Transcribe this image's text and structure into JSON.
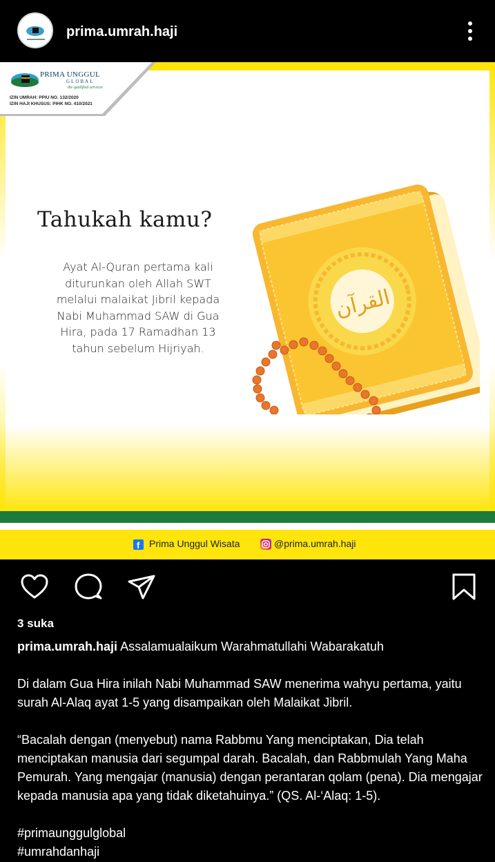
{
  "header": {
    "username": "prima.umrah.haji",
    "avatar_icon": "prima-unggul-logo-avatar",
    "more_icon": "more-vertical-icon"
  },
  "post_image": {
    "logo": {
      "brand_name": "PRIMA UNGGUL",
      "brand_sub": "GLOBAL",
      "tagline": "the qualified services",
      "izin_umrah": "IZIN UMRAH: PPIU NO. 132/2020",
      "izin_haji": "IZIN HAJI KHUSUS: PIHK NO. 410/2021"
    },
    "title": "Tahukah kamu?",
    "body_lines": [
      "Ayat Al-Quran pertama kali",
      "diturunkan oleh Allah SWT",
      "melalui malaikat Jibril kepada",
      "Nabi Muhammad SAW  di Gua",
      "Hira, pada 17 Ramadhan 13",
      "tahun sebelum Hijriyah."
    ],
    "quran_label": "القرآن",
    "footer": {
      "facebook_label": "Prima Unggul Wisata",
      "instagram_label": "@prima.umrah.haji"
    },
    "colors": {
      "yellow": "#ffe50c",
      "green": "#1f7a3e",
      "book": "#f7b731",
      "beads": "#e8762b"
    }
  },
  "actions": {
    "like_icon": "heart-icon",
    "comment_icon": "comment-icon",
    "share_icon": "send-icon",
    "save_icon": "bookmark-icon"
  },
  "likes": "3 suka",
  "caption": {
    "username": "prima.umrah.haji",
    "first_line": "Assalamualaikum Warahmatullahi Wabarakatuh",
    "paragraph1": "Di dalam Gua Hira inilah Nabi Muhammad SAW menerima wahyu pertama, yaitu surah Al-Alaq ayat 1-5 yang disampaikan oleh Malaikat Jibril.",
    "paragraph2": "“Bacalah dengan (menyebut) nama Rabbmu Yang menciptakan, Dia telah menciptakan manusia dari segumpal darah. Bacalah, dan Rabbmulah Yang Maha Pemurah. Yang mengajar (manusia) dengan perantaran qolam (pena). Dia mengajar kepada manusia apa yang tidak diketahuinya.” (QS. Al-‘Alaq: 1-5).",
    "hashtags": [
      "#primaunggulglobal",
      "#umrahdanhaji"
    ]
  }
}
